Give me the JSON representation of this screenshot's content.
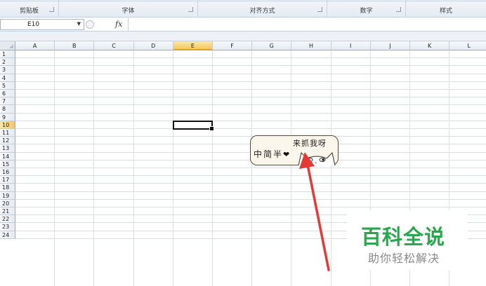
{
  "ribbon": {
    "groups": [
      {
        "label": "剪贴板"
      },
      {
        "label": "字体"
      },
      {
        "label": "对齐方式"
      },
      {
        "label": "数字"
      },
      {
        "label": "样式"
      }
    ]
  },
  "formula_bar": {
    "name_box": "E10",
    "fx_label": "fx",
    "content": ""
  },
  "sheet": {
    "columns": [
      "A",
      "B",
      "C",
      "D",
      "E",
      "F",
      "G",
      "H",
      "I",
      "J",
      "K",
      "L"
    ],
    "rows": [
      "1",
      "2",
      "3",
      "4",
      "5",
      "6",
      "7",
      "8",
      "9",
      "10",
      "11",
      "12",
      "13",
      "14",
      "15",
      "16",
      "17",
      "18",
      "19",
      "20",
      "21",
      "22",
      "23",
      "24"
    ],
    "selected_column": "E",
    "selected_row": "10"
  },
  "sticker": {
    "line1": "来抓我呀",
    "line2": "中简半",
    "heart": "❤"
  },
  "watermark": {
    "title": "百科全说",
    "subtitle": "助你轻松解决"
  },
  "colors": {
    "watermark_green": "#27a84a",
    "arrow_red": "#e53935",
    "selection_header": "#f5c660"
  }
}
